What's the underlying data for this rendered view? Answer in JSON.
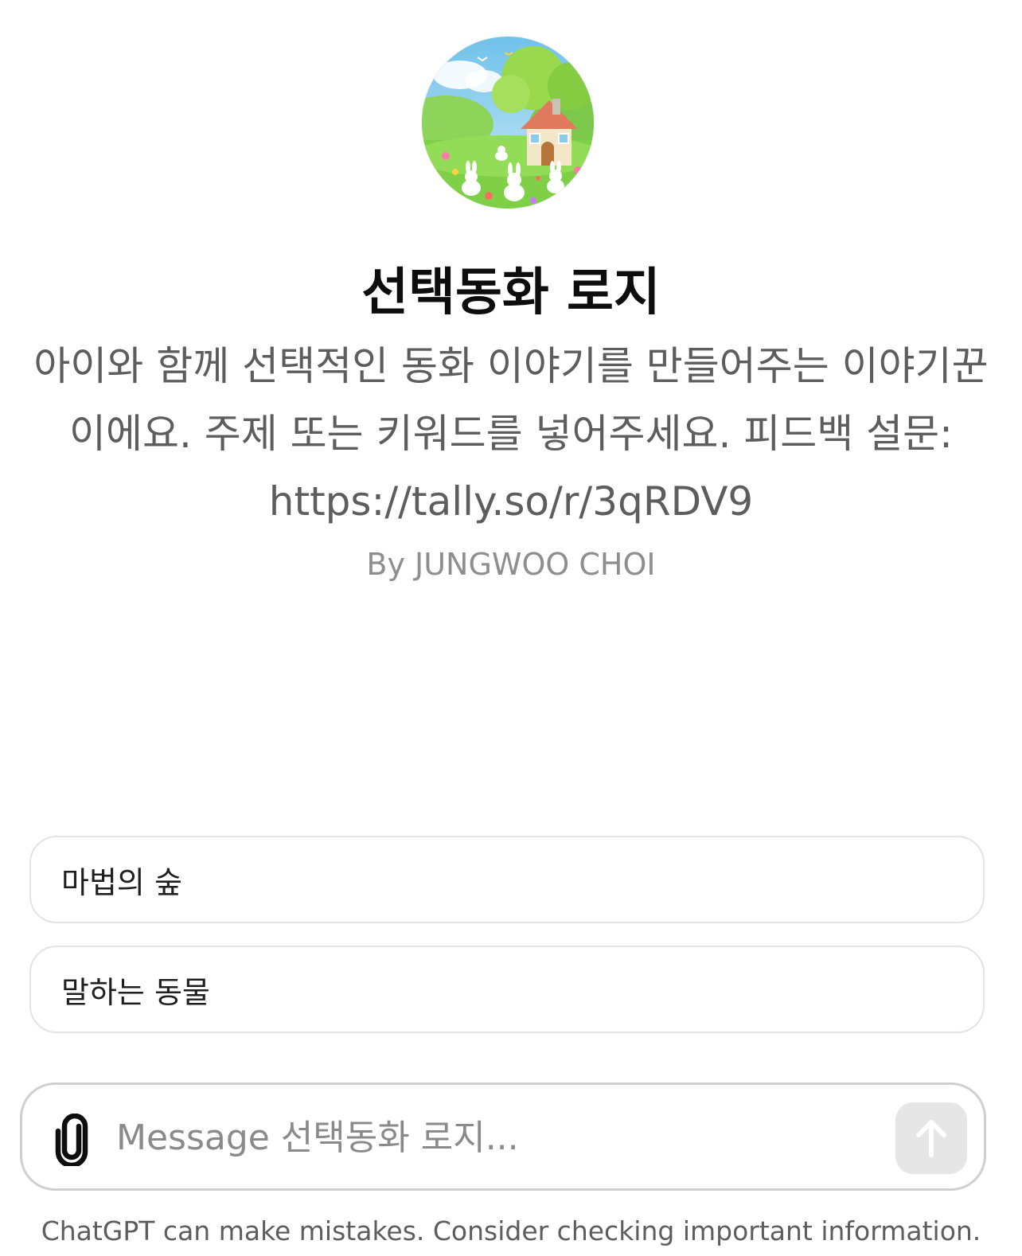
{
  "gpt": {
    "name": "선택동화 로지",
    "description": "아이와 함께 선택적인 동화 이야기를 만들어주는 이야기꾼이에요. 주제 또는 키워드를 넣어주세요. 피드백 설문: https://tally.so/r/3qRDV9",
    "author": "By JUNGWOO CHOI",
    "avatar_icon": "fairytale-cottage-bunnies-avatar"
  },
  "conversation_starters": [
    {
      "label": "마법의 숲"
    },
    {
      "label": "말하는 동물"
    }
  ],
  "composer": {
    "placeholder": "Message 선택동화 로지...",
    "value": "",
    "attach_icon": "paperclip-icon",
    "send_icon": "arrow-up-icon"
  },
  "footer": {
    "disclaimer": "ChatGPT can make mistakes. Consider checking important information."
  },
  "colors": {
    "background": "#ffffff",
    "title": "#0d0d0d",
    "description": "#5d5d5d",
    "author": "#8e8e8e",
    "border": "#e3e3e3",
    "send_button_disabled": "#e6e6e6"
  }
}
